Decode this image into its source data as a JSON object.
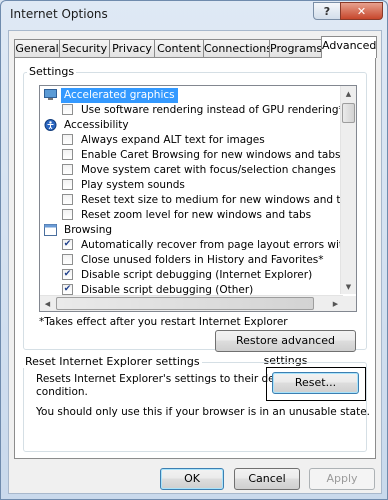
{
  "window": {
    "title": "Internet Options",
    "help_label": "?",
    "close_label": "✕"
  },
  "tabs": [
    {
      "label": "General"
    },
    {
      "label": "Security"
    },
    {
      "label": "Privacy"
    },
    {
      "label": "Content"
    },
    {
      "label": "Connections"
    },
    {
      "label": "Programs"
    },
    {
      "label": "Advanced",
      "active": true
    }
  ],
  "settings": {
    "group_label": "Settings",
    "items": [
      {
        "kind": "category",
        "label": "Accelerated graphics",
        "icon": "monitor-icon",
        "selected": true
      },
      {
        "kind": "checkbox",
        "label": "Use software rendering instead of GPU rendering*",
        "checked": false
      },
      {
        "kind": "category",
        "label": "Accessibility",
        "icon": "accessibility-icon"
      },
      {
        "kind": "checkbox",
        "label": "Always expand ALT text for images",
        "checked": false
      },
      {
        "kind": "checkbox",
        "label": "Enable Caret Browsing for new windows and tabs",
        "checked": false
      },
      {
        "kind": "checkbox",
        "label": "Move system caret with focus/selection changes",
        "checked": false
      },
      {
        "kind": "checkbox",
        "label": "Play system sounds",
        "checked": false
      },
      {
        "kind": "checkbox",
        "label": "Reset text size to medium for new windows and tabs",
        "checked": false
      },
      {
        "kind": "checkbox",
        "label": "Reset zoom level for new windows and tabs",
        "checked": false
      },
      {
        "kind": "category",
        "label": "Browsing",
        "icon": "browsing-icon"
      },
      {
        "kind": "checkbox",
        "label": "Automatically recover from page layout errors with Compa",
        "checked": true
      },
      {
        "kind": "checkbox",
        "label": "Close unused folders in History and Favorites*",
        "checked": false
      },
      {
        "kind": "checkbox",
        "label": "Disable script debugging (Internet Explorer)",
        "checked": true
      },
      {
        "kind": "checkbox",
        "label": "Disable script debugging (Other)",
        "checked": true
      }
    ],
    "footnote": "*Takes effect after you restart Internet Explorer",
    "restore_button": "Restore advanced settings"
  },
  "reset": {
    "group_label": "Reset Internet Explorer settings",
    "description_line1": "Resets Internet Explorer's settings to their default",
    "description_line2": "condition.",
    "warning": "You should only use this if your browser is in an unusable state.",
    "reset_button": "Reset..."
  },
  "footer": {
    "ok": "OK",
    "cancel": "Cancel",
    "apply": "Apply"
  }
}
